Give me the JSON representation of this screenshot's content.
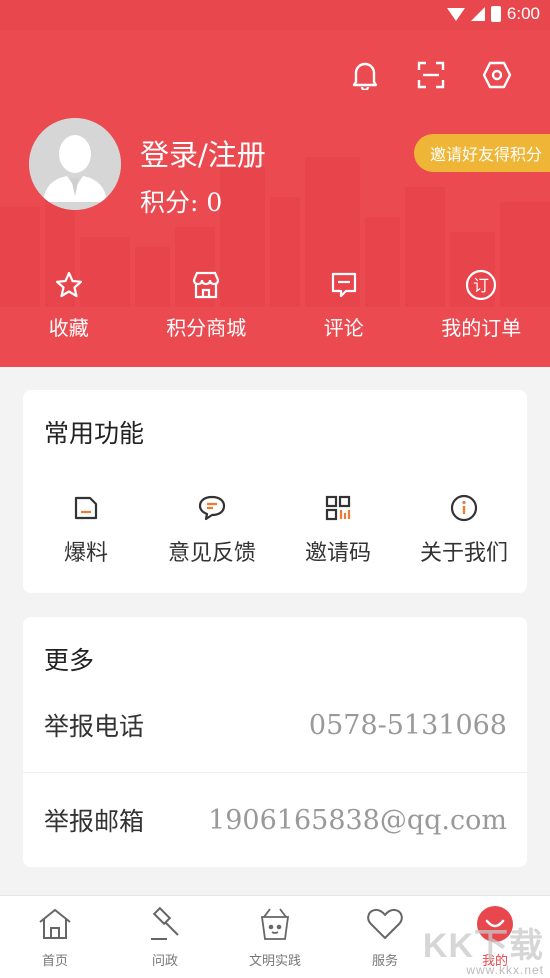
{
  "status_bar": {
    "time": "6:00"
  },
  "header": {
    "login_text": "登录/注册",
    "points_text": "积分: 0",
    "invite_text": "邀请好友得积分",
    "actions": [
      {
        "label": "收藏",
        "icon": "star-icon"
      },
      {
        "label": "积分商城",
        "icon": "store-icon"
      },
      {
        "label": "评论",
        "icon": "comment-icon"
      },
      {
        "label": "我的订单",
        "icon": "order-icon"
      }
    ],
    "top_icons": [
      "bell-icon",
      "scan-icon",
      "settings-icon"
    ]
  },
  "common": {
    "title": "常用功能",
    "items": [
      {
        "label": "爆料",
        "icon": "tipoff-icon"
      },
      {
        "label": "意见反馈",
        "icon": "feedback-icon"
      },
      {
        "label": "邀请码",
        "icon": "qrcode-icon"
      },
      {
        "label": "关于我们",
        "icon": "info-icon"
      }
    ]
  },
  "more": {
    "title": "更多",
    "rows": [
      {
        "label": "举报电话",
        "value": "0578-5131068"
      },
      {
        "label": "举报邮箱",
        "value": "1906165838@qq.com"
      }
    ]
  },
  "bottom_nav": {
    "items": [
      {
        "label": "首页",
        "icon": "home-icon"
      },
      {
        "label": "问政",
        "icon": "gavel-icon"
      },
      {
        "label": "文明实践",
        "icon": "basket-icon"
      },
      {
        "label": "服务",
        "icon": "heart-icon"
      },
      {
        "label": "我的",
        "icon": "smile-icon",
        "active": true
      }
    ]
  },
  "watermark": {
    "text": "KK下载",
    "url": "www.kkx.net"
  },
  "colors": {
    "brand": "#e8474e",
    "invite": "#efb536",
    "accent_orange": "#f07a2e"
  }
}
